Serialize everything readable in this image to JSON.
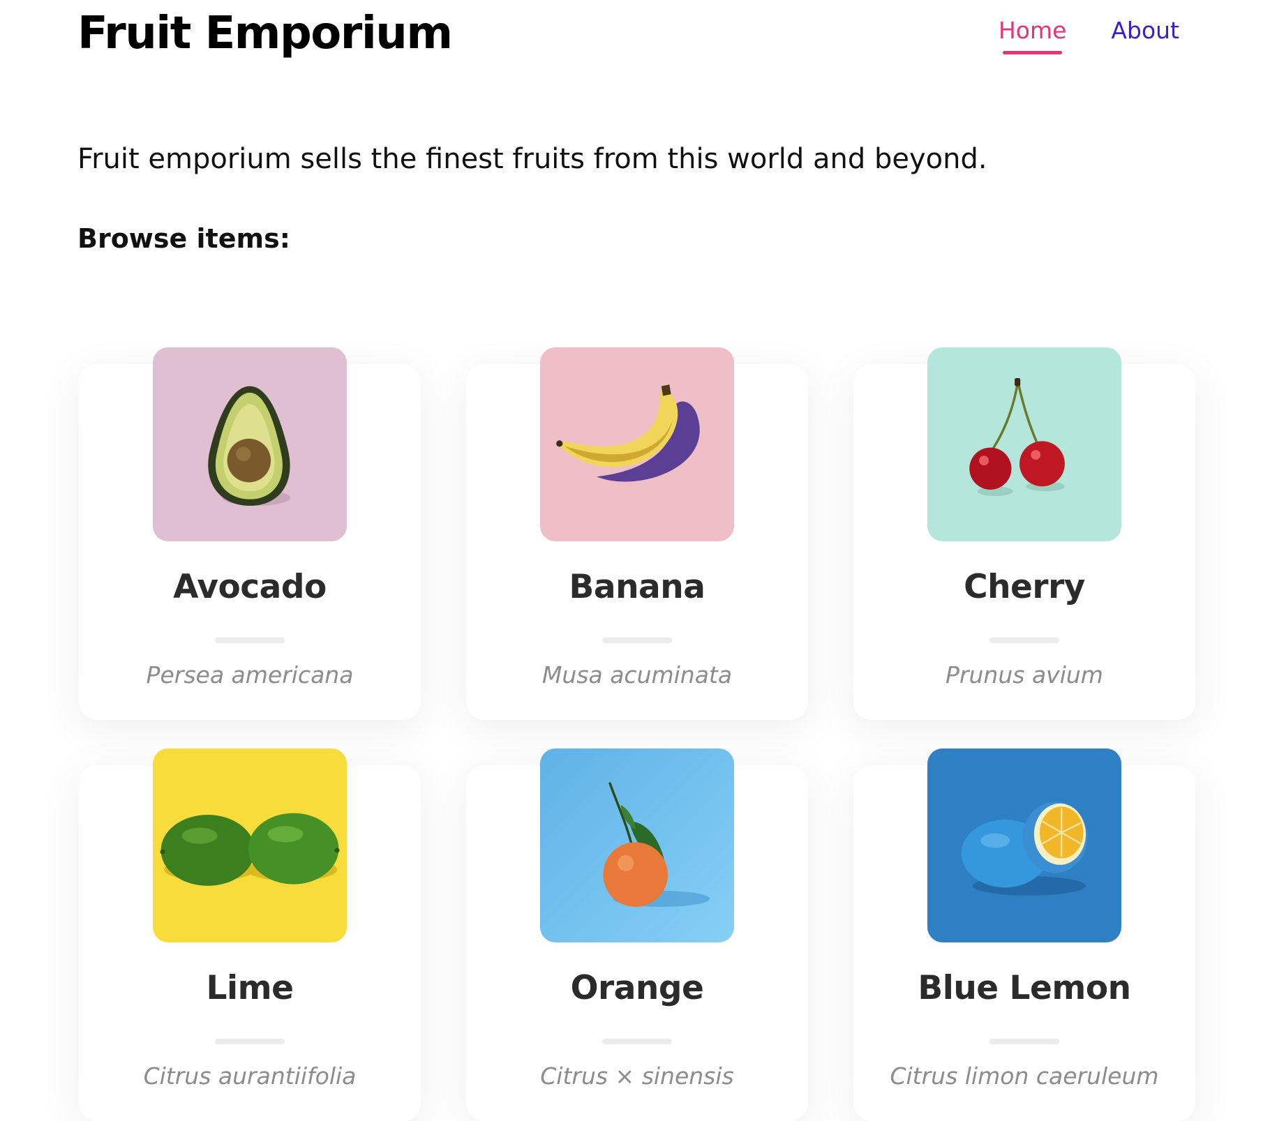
{
  "header": {
    "title": "Fruit Emporium",
    "nav": [
      {
        "label": "Home",
        "active": true,
        "color": "#e8337a"
      },
      {
        "label": "About",
        "active": false,
        "color": "#3a1fd1"
      }
    ]
  },
  "intro": "Fruit emporium sells the finest fruits from this world and beyond.",
  "browse_label": "Browse items:",
  "items": [
    {
      "name": "Avocado",
      "scientific": "Persea americana",
      "image_icon": "avocado-icon",
      "bg_color": "#e0bfd2"
    },
    {
      "name": "Banana",
      "scientific": "Musa acuminata",
      "image_icon": "banana-icon",
      "bg_color": "#f0bec7"
    },
    {
      "name": "Cherry",
      "scientific": "Prunus avium",
      "image_icon": "cherry-icon",
      "bg_color": "#b5e6dc"
    },
    {
      "name": "Lime",
      "scientific": "Citrus aurantiifolia",
      "image_icon": "lime-icon",
      "bg_color": "#f8dc3c"
    },
    {
      "name": "Orange",
      "scientific": "Citrus × sinensis",
      "image_icon": "orange-icon",
      "bg_color": "#72bdea"
    },
    {
      "name": "Blue Lemon",
      "scientific": "Citrus limon caeruleum",
      "image_icon": "blue-lemon-icon",
      "bg_color": "#2f7fc4"
    }
  ]
}
